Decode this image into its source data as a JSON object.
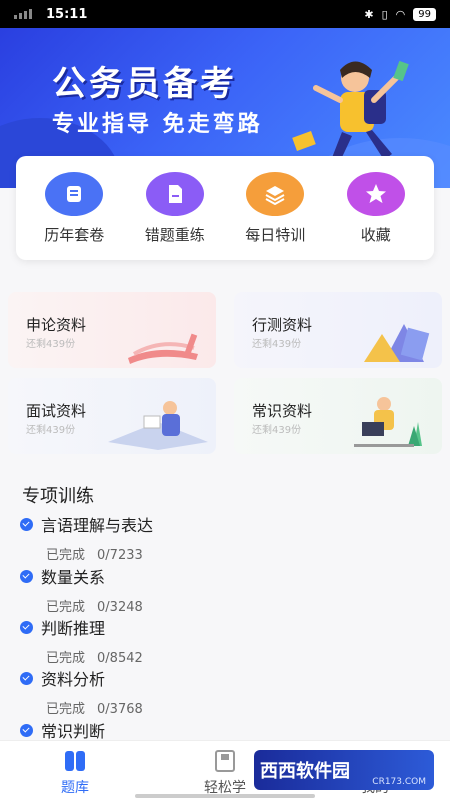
{
  "status_bar": {
    "time": "15:11",
    "battery": "99"
  },
  "banner": {
    "title": "公务员备考",
    "subtitle": "专业指导 免走弯路"
  },
  "quick_menu": [
    {
      "label": "历年套卷",
      "icon": "scroll-icon",
      "color": "#4a72f5"
    },
    {
      "label": "错题重练",
      "icon": "document-icon",
      "color": "#8b5cf6"
    },
    {
      "label": "每日特训",
      "icon": "layers-icon",
      "color": "#f59e3b"
    },
    {
      "label": "收藏",
      "icon": "star-icon",
      "color": "#c050e8"
    }
  ],
  "materials": [
    {
      "title": "申论资料",
      "sub": "还剩439份"
    },
    {
      "title": "行测资料",
      "sub": "还剩439份"
    },
    {
      "title": "面试资料",
      "sub": "还剩439份"
    },
    {
      "title": "常识资料",
      "sub": "还剩439份"
    }
  ],
  "training": {
    "title": "专项训练",
    "items": [
      {
        "name": "言语理解与表达",
        "status": "已完成",
        "progress": "0/7233"
      },
      {
        "name": "数量关系",
        "status": "已完成",
        "progress": "0/3248"
      },
      {
        "name": "判断推理",
        "status": "已完成",
        "progress": "0/8542"
      },
      {
        "name": "资料分析",
        "status": "已完成",
        "progress": "0/3768"
      },
      {
        "name": "常识判断",
        "status": "",
        "progress": ""
      }
    ]
  },
  "bottom_nav": [
    {
      "label": "题库",
      "icon": "question-bank-icon",
      "active": true
    },
    {
      "label": "轻松学",
      "icon": "book-icon",
      "active": false
    },
    {
      "label": "我的",
      "icon": "profile-icon",
      "active": false
    }
  ],
  "watermark": {
    "text": "西西软件园",
    "url": "CR173.COM"
  },
  "colors": {
    "accent": "#2f6cf6",
    "banner": "#3b63f7"
  }
}
